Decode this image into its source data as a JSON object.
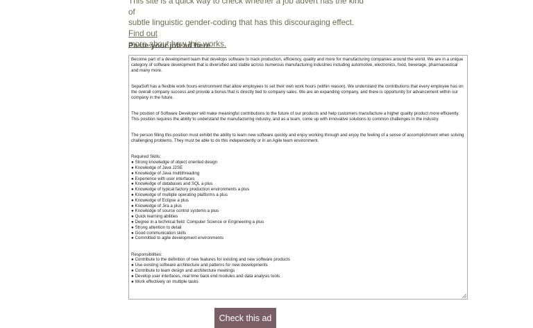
{
  "intro": {
    "text_line1": "This site is a quick way to check whether a job advert has the kind of",
    "text_line2": "subtle linguistic gender-coding that has this discouraging effect.",
    "link_part1": "Find out",
    "link_part2": "more about how this works."
  },
  "form": {
    "label": "Paste your job ad here",
    "paragraphs": [
      "Become part of a development team that develops software to track production, efficiency, quality and more for manufacturing companies around the world. We are in a unique category of software development that is diversified and stable across numerous manufacturing industries including automotive, electronics, food, beverage, pharmaceutical and many more.",
      "SepaSoft has a flexible work hours environment that allow employees to set their own work hours (within reason). We understand the contributions that every employee has on the overall company success and provide a bonus that is directly tied to company sales. We are an expanding company, and there is opportunity for advancement within our company in the future.",
      "The position of Software Developer will make meaningful contributions to the future of our products and help customers manufacture a higher quality product more efficiently. This position requires the ability to understand the manufacturing industry, and as a team, come up with innovative solutions to common challenges in the industry.",
      "The person filling this position must exhibit the ability to learn new software quickly and enjoy working through and enjoy the feeling of a sense of accomplishment when solving challenging problems. They must be able to do this independently or in an Agile team environment."
    ],
    "skills_heading": "Required Skills:",
    "skills": [
      "● Strong knowledge of object oriented design",
      "● Knowledge of Java J2SE",
      "● Knowledge of Java multithreading",
      "● Experience with user interfaces",
      "● Knowledge of databases and SQL a plus",
      "● Knowledge of typical factory production environments a plus",
      "● Knowledge of multiple operating platforms a plus",
      "● Knowledge of Eclipse a plus",
      "● Knowledge of Jira a plus",
      "● Knowledge of source control systems a plus",
      "● Quick learning abilities",
      "● Degree in a technical field: Computer Science or Engineering a plus",
      "● Strong attention to detail",
      "● Good communication skills",
      "● Committed to agile development environments"
    ],
    "resp_heading": "Responsibilities:",
    "responsibilities": [
      "● Contribute to the definition of new features for existing and new software products",
      "● Use existing software architecture and patterns for new developments",
      "● Contribute to team design and architecture meetings",
      "● Develop user interfaces, real time back end modules and data analysis tools",
      "● Work effectively on multiple tasks"
    ],
    "button_label": "Check this ad"
  },
  "colors": {
    "intro_text": "#6e6a52",
    "button_bg": "#7a5e66",
    "button_text": "#ffffff"
  }
}
